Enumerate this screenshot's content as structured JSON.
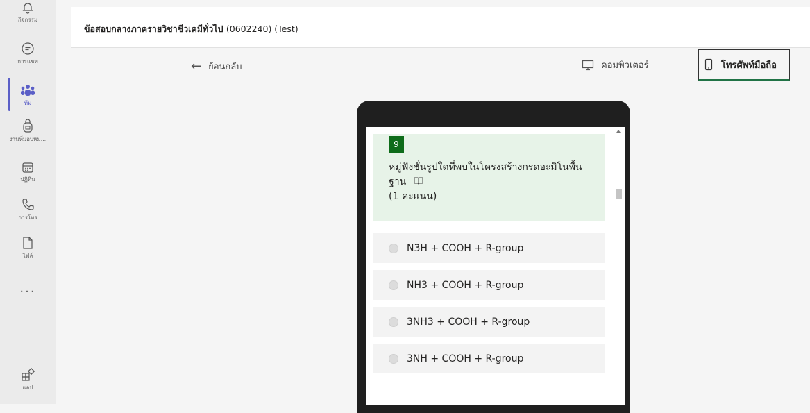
{
  "rail": {
    "items": [
      {
        "label": "กิจกรรม",
        "icon": "bell-icon"
      },
      {
        "label": "การแชท",
        "icon": "chat-icon"
      },
      {
        "label": "ทีม",
        "icon": "teams-icon"
      },
      {
        "label": "งานที่มอบหม...",
        "icon": "backpack-icon"
      },
      {
        "label": "ปฏิทิน",
        "icon": "calendar-icon"
      },
      {
        "label": "การโทร",
        "icon": "phone-icon"
      },
      {
        "label": "ไฟล์",
        "icon": "file-icon"
      }
    ],
    "more": "...",
    "apps": {
      "label": "แอป",
      "icon": "apps-icon"
    }
  },
  "header": {
    "title": "ข้อสอบกลางภาครายวิชาชีวเคมีทั่วไป",
    "code": "(0602240) (Test)"
  },
  "toolbar": {
    "back_label": "ย้อนกลับ",
    "computer_label": "คอมพิวเตอร์",
    "mobile_label": "โทรศัพท์มือถือ"
  },
  "question": {
    "number": "9",
    "text": "หมู่ฟังชั่นรูปใดที่พบในโครงสร้างกรดอะมิโนพื้นฐาน",
    "points": "(1 คะแนน)",
    "options": [
      "N3H + COOH + R-group",
      "NH3 + COOH + R-group",
      "3NH3 + COOH + R-group",
      "3NH + COOH + R-group"
    ]
  },
  "colors": {
    "accent": "#5b5fc7",
    "question_bg": "#e7f3e8",
    "number_bg": "#0e6c1a"
  }
}
